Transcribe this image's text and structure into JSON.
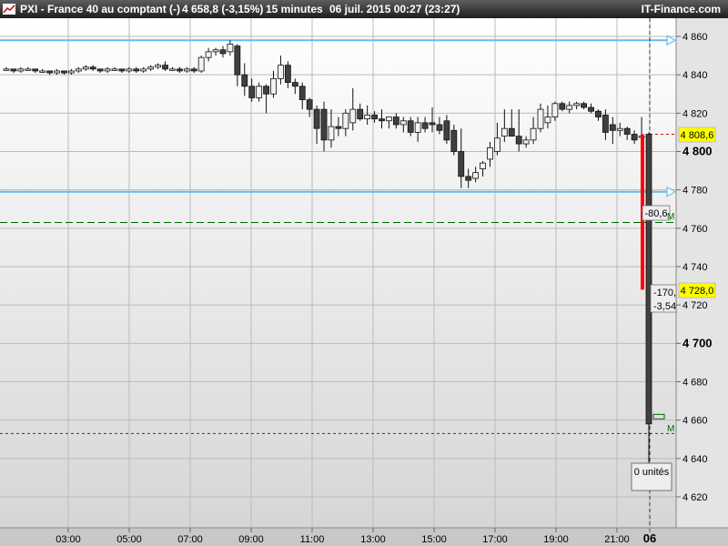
{
  "title_bar": {
    "title": "PXI - France 40 au comptant (-)",
    "last_value": "4 658,8 (-3,15%)",
    "interval": "15 minutes",
    "date": "06 juil. 2015 00:27 (23:27)",
    "brand": "IT-Finance.com"
  },
  "colors": {
    "hline": "#66bbee",
    "dashed_green": "#006600",
    "bull_candle": "#f2f2f2",
    "bear_candle": "#404040",
    "highlight": "#ffff00",
    "red_bar": "#ff0000"
  },
  "chart_data": {
    "type": "candlestick",
    "instrument": "PXI - France 40 au comptant (-)",
    "interval": "15 minutes",
    "y_axis": {
      "range": [
        4605,
        4870
      ],
      "ticks": [
        4620,
        4640,
        4660,
        4680,
        4700,
        4720,
        4740,
        4760,
        4780,
        4800,
        4820,
        4840,
        4860
      ],
      "tick_labels": [
        "4 620",
        "4 640",
        "4 660",
        "4 680",
        "4 700",
        "4 720",
        "4 740",
        "4 760",
        "4 780",
        "4 800",
        "4 820",
        "4 840",
        "4 860"
      ],
      "bold_ticks": [
        4700,
        4800
      ]
    },
    "x_axis": {
      "labels": [
        "03:00",
        "05:00",
        "07:00",
        "09:00",
        "11:00",
        "13:00",
        "15:00",
        "17:00",
        "19:00",
        "21:00",
        "06"
      ],
      "bold_labels": [
        "06"
      ]
    },
    "candles": [
      [
        4843,
        4844,
        4842,
        4843
      ],
      [
        4843,
        4843,
        4841,
        4842
      ],
      [
        4842,
        4844,
        4841,
        4843
      ],
      [
        4843,
        4844,
        4842,
        4843
      ],
      [
        4843,
        4843,
        4841,
        4842
      ],
      [
        4842,
        4843,
        4841,
        4842
      ],
      [
        4842,
        4842,
        4840,
        4841
      ],
      [
        4841,
        4843,
        4840,
        4842
      ],
      [
        4842,
        4842,
        4840,
        4841
      ],
      [
        4841,
        4843,
        4840,
        4842
      ],
      [
        4842,
        4844,
        4841,
        4843
      ],
      [
        4843,
        4845,
        4842,
        4844
      ],
      [
        4844,
        4845,
        4842,
        4843
      ],
      [
        4843,
        4843,
        4841,
        4842
      ],
      [
        4842,
        4844,
        4841,
        4843
      ],
      [
        4843,
        4844,
        4842,
        4843
      ],
      [
        4843,
        4843,
        4841,
        4842
      ],
      [
        4842,
        4844,
        4841,
        4843
      ],
      [
        4843,
        4844,
        4841,
        4842
      ],
      [
        4842,
        4844,
        4841,
        4843
      ],
      [
        4843,
        4845,
        4842,
        4844
      ],
      [
        4844,
        4846,
        4843,
        4845
      ],
      [
        4845,
        4847,
        4842,
        4843
      ],
      [
        4843,
        4844,
        4842,
        4843
      ],
      [
        4843,
        4844,
        4841,
        4842
      ],
      [
        4842,
        4844,
        4841,
        4843
      ],
      [
        4843,
        4844,
        4841,
        4842
      ],
      [
        4842,
        4850,
        4841,
        4849
      ],
      [
        4849,
        4854,
        4847,
        4852
      ],
      [
        4852,
        4854,
        4850,
        4853
      ],
      [
        4853,
        4855,
        4849,
        4851
      ],
      [
        4852,
        4858,
        4850,
        4856
      ],
      [
        4855,
        4856,
        4834,
        4840
      ],
      [
        4840,
        4846,
        4829,
        4834
      ],
      [
        4834,
        4838,
        4826,
        4828
      ],
      [
        4828,
        4836,
        4826,
        4834
      ],
      [
        4834,
        4835,
        4820,
        4830
      ],
      [
        4830,
        4842,
        4828,
        4838
      ],
      [
        4838,
        4850,
        4835,
        4845
      ],
      [
        4845,
        4847,
        4833,
        4836
      ],
      [
        4836,
        4838,
        4830,
        4834
      ],
      [
        4834,
        4836,
        4822,
        4827
      ],
      [
        4827,
        4828,
        4818,
        4822
      ],
      [
        4822,
        4824,
        4804,
        4812
      ],
      [
        4822,
        4826,
        4800,
        4806
      ],
      [
        4806,
        4822,
        4802,
        4813
      ],
      [
        4813,
        4818,
        4808,
        4812
      ],
      [
        4812,
        4822,
        4808,
        4820
      ],
      [
        4815,
        4833,
        4811,
        4822
      ],
      [
        4822,
        4825,
        4816,
        4817
      ],
      [
        4817,
        4824,
        4814,
        4819
      ],
      [
        4819,
        4821,
        4815,
        4817
      ],
      [
        4817,
        4822,
        4812,
        4816
      ],
      [
        4816,
        4818,
        4812,
        4818
      ],
      [
        4818,
        4820,
        4812,
        4814
      ],
      [
        4814,
        4818,
        4810,
        4816
      ],
      [
        4816,
        4818,
        4808,
        4810
      ],
      [
        4810,
        4818,
        4805,
        4815
      ],
      [
        4815,
        4818,
        4810,
        4812
      ],
      [
        4815,
        4823,
        4810,
        4814
      ],
      [
        4814,
        4818,
        4809,
        4811
      ],
      [
        4816,
        4819,
        4804,
        4806
      ],
      [
        4811,
        4814,
        4798,
        4800
      ],
      [
        4800,
        4812,
        4781,
        4787
      ],
      [
        4787,
        4791,
        4781,
        4785
      ],
      [
        4786,
        4792,
        4784,
        4789
      ],
      [
        4791,
        4795,
        4787,
        4794
      ],
      [
        4796,
        4805,
        4792,
        4802
      ],
      [
        4800,
        4815,
        4798,
        4807
      ],
      [
        4808,
        4822,
        4805,
        4812
      ],
      [
        4812,
        4822,
        4809,
        4808
      ],
      [
        4808,
        4822,
        4800,
        4804
      ],
      [
        4804,
        4808,
        4802,
        4806
      ],
      [
        4806,
        4818,
        4804,
        4812
      ],
      [
        4812,
        4825,
        4810,
        4822
      ],
      [
        4815,
        4824,
        4812,
        4818
      ],
      [
        4818,
        4826,
        4816,
        4825
      ],
      [
        4825,
        4826,
        4821,
        4822
      ],
      [
        4822,
        4826,
        4820,
        4824
      ],
      [
        4824,
        4826,
        4822,
        4825
      ],
      [
        4825,
        4826,
        4822,
        4823
      ],
      [
        4823,
        4825,
        4820,
        4821
      ],
      [
        4821,
        4822,
        4816,
        4818
      ],
      [
        4819,
        4822,
        4806,
        4810
      ],
      [
        4814,
        4818,
        4804,
        4811
      ],
      [
        4811,
        4815,
        4808,
        4812
      ],
      [
        4812,
        4813,
        4806,
        4809
      ],
      [
        4809,
        4811,
        4804,
        4806
      ],
      [
        4808,
        4818,
        4804,
        4808
      ],
      [
        4809,
        4810,
        4637,
        4658
      ]
    ],
    "horizontal_lines": [
      {
        "kind": "solid-arrow",
        "value": 4858
      },
      {
        "kind": "solid-arrow",
        "value": 4779
      },
      {
        "kind": "dashed",
        "value": 4763
      },
      {
        "kind": "dashed",
        "value": 4653
      }
    ],
    "price_labels": [
      {
        "text": "4 808,6",
        "value": 4809
      },
      {
        "text": "4 728,0",
        "value": 4728
      }
    ],
    "annotations": [
      "-80,6",
      "M",
      "-170,",
      "-3,54",
      "M",
      "0 unités"
    ]
  }
}
